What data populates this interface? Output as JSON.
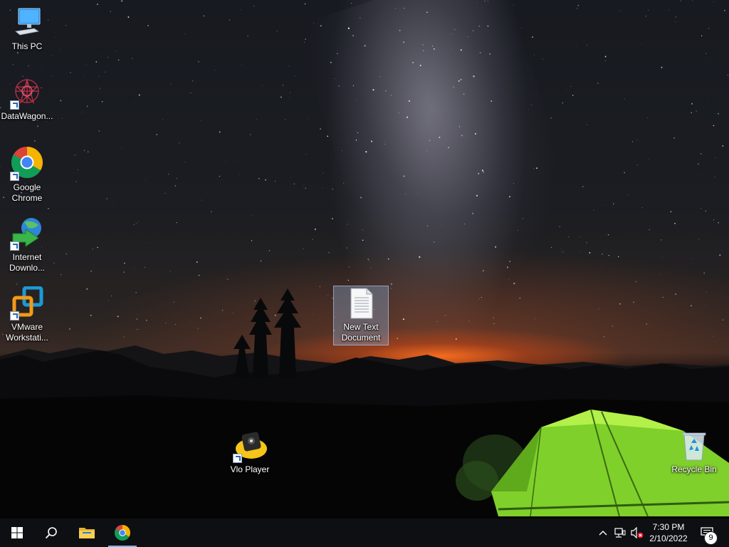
{
  "desktop": {
    "icons": [
      {
        "label": "This PC",
        "icon": "computer-icon"
      },
      {
        "label": "DataWagon...",
        "icon": "datawagon-icon"
      },
      {
        "label": "Google Chrome",
        "icon": "chrome-icon"
      },
      {
        "label": "Internet Downlo...",
        "icon": "internet-download-manager-icon"
      },
      {
        "label": "VMware Workstati...",
        "icon": "vmware-icon"
      },
      {
        "label": "New Text Document",
        "icon": "text-document-icon",
        "selected": true
      },
      {
        "label": "Vlo Player",
        "icon": "vlo-player-icon"
      },
      {
        "label": "Recycle Bin",
        "icon": "recycle-bin-icon"
      }
    ]
  },
  "taskbar": {
    "start": "windows-start-icon",
    "search": "search-icon",
    "pinned": [
      {
        "name": "File Explorer",
        "icon": "folder-icon"
      },
      {
        "name": "Google Chrome",
        "icon": "chrome-icon",
        "active": true
      }
    ],
    "tray": {
      "chevron": "chevron-up-icon",
      "network": "network-icon",
      "volume": "volume-muted-icon",
      "time": "7:30 PM",
      "date": "2/10/2022",
      "notification_count": "9"
    }
  },
  "colors": {
    "taskbar": "#0e0f12",
    "accent": "#7ab3ea",
    "tent": "#8ee02a",
    "horizon": "#ff6e1e"
  }
}
